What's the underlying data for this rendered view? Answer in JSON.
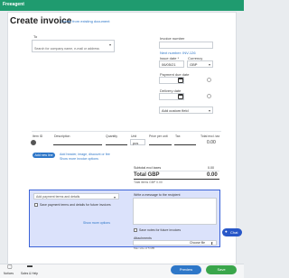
{
  "app": {
    "brand": "Freeagent"
  },
  "header": {
    "title": "Create invoice",
    "subtitle_link": "Create from existing document"
  },
  "to": {
    "label": "To",
    "placeholder": "Search for company name, e-mail or address"
  },
  "invoice_meta": {
    "invoice_number_label": "Invoice number",
    "next_number": "Next number: INV-126",
    "issue_date_label": "Issue date *",
    "issue_date": "06/05/21",
    "currency_label": "Currency",
    "currency": "GBP",
    "payment_due_label": "Payment due date",
    "delivery_date_label": "Delivery date",
    "add_custom_field": "Add custom field"
  },
  "line_items": {
    "columns": [
      "Item ID",
      "Description",
      "Quantity",
      "Unit",
      "Price per unit",
      "Tax",
      "Total excl. tax"
    ],
    "unit_value": "pcs",
    "total_value": "0.00",
    "add_line_button": "Add new line",
    "links": [
      "Add header, image, discount or fee",
      "Show more invoice options"
    ]
  },
  "summary": {
    "subtotal_label": "Subtotal excl taxes",
    "subtotal_value": "0.00",
    "total_label": "Total GBP",
    "total_value": "0.00",
    "total_note": "Total items GBP 0.00"
  },
  "footer_panel": {
    "terms_placeholder": "Add payment terms and details",
    "save_terms_label": "Save payment terms and details for future invoices",
    "show_more": "Show more options",
    "message_label": "Write a message to the recipient",
    "save_message_label": "Save notes for future invoices",
    "attachments_label": "Attachments",
    "choose_file": "Choose file",
    "file_note": "Max size of 5 MB"
  },
  "actions": {
    "preview": "Preview",
    "save": "Save"
  },
  "chat": {
    "label": "Chat"
  },
  "bottom_nav": {
    "items": [
      "Notices",
      "Sales & Help"
    ]
  }
}
